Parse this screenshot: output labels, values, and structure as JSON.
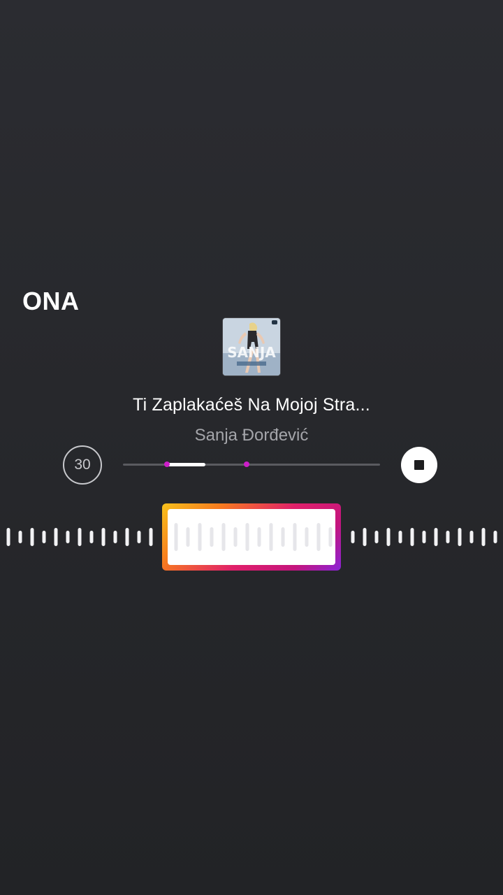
{
  "sticker": {
    "text": "ONA"
  },
  "music_sticker": {
    "album_art_icon": "album-cover-image",
    "song_title": "Ti Zaplakaćeš Na Mojoj Stra...",
    "artist": "Sanja Đorđević",
    "clip_duration": "30",
    "stop_icon": "stop-icon",
    "clip_position": {
      "selection_start": 0.17,
      "selection_end": 0.32,
      "marker_start": 0.17,
      "marker_playhead": 0.48
    }
  },
  "colors": {
    "background": "#28292d",
    "accent_marker": "#cc1ec8",
    "gradient": [
      "#f7c21b",
      "#f77a1f",
      "#e0206a",
      "#c4157d",
      "#8a24d8"
    ]
  }
}
